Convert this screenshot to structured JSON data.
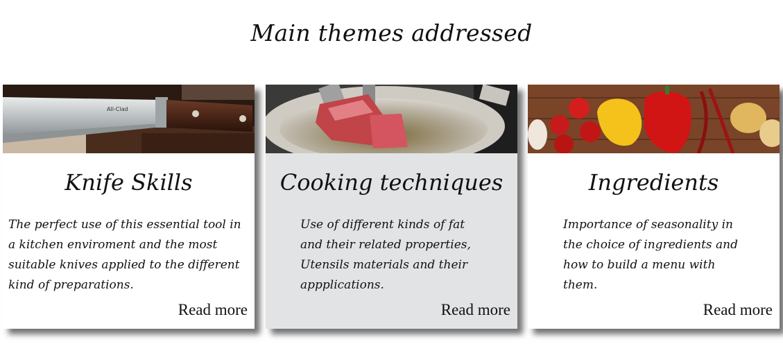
{
  "section": {
    "title": "Main themes addressed"
  },
  "cards": [
    {
      "title": "Knife Skills",
      "text": "The perfect use of this essential tool in a kitchen enviroment and the most suitable knives applied to the different kind of preparations.",
      "read_more": "Read more",
      "image": {
        "subject": "chef knife on wooden board",
        "brand_mark": "All-Clad"
      }
    },
    {
      "title": "Cooking techniques",
      "text": "Use of different kinds of fat and their related properties, Utensils materials and their appplications.",
      "read_more": "Read more",
      "image": {
        "subject": "tuna steak frying in a pan"
      }
    },
    {
      "title": "Ingredients",
      "text": "Importance of seasonality in the choice of ingredients and how to build a menu with them.",
      "read_more": "Read more",
      "image": {
        "subject": "vegetables on wooden table"
      }
    }
  ],
  "colors": {
    "active_card_bg": "#e2e3e4",
    "card_bg": "#ffffff",
    "text": "#111111"
  }
}
